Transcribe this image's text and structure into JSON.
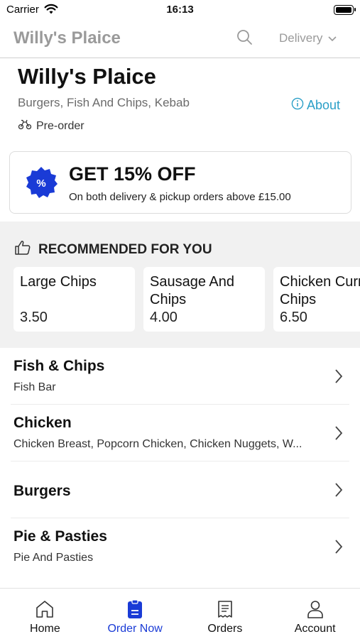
{
  "status": {
    "carrier": "Carrier",
    "time": "16:13"
  },
  "nav": {
    "title": "Willy's Plaice",
    "delivery_label": "Delivery"
  },
  "restaurant": {
    "name": "Willy's Plaice",
    "cuisine": "Burgers, Fish And Chips, Kebab",
    "about_label": "About",
    "preorder_label": "Pre-order"
  },
  "offer": {
    "title": "GET 15% OFF",
    "subtitle": "On both delivery & pickup orders above £15.00",
    "badge_color": "#1a3bd6"
  },
  "recommended": {
    "heading": "RECOMMENDED FOR YOU",
    "items": [
      {
        "name": "Large Chips",
        "price": "3.50"
      },
      {
        "name": "Sausage And Chips",
        "price": "4.00"
      },
      {
        "name": "Chicken Curry & Chips",
        "price": "6.50"
      }
    ]
  },
  "categories": [
    {
      "title": "Fish & Chips",
      "subtitle": "Fish Bar"
    },
    {
      "title": "Chicken",
      "subtitle": "Chicken Breast, Popcorn Chicken, Chicken Nuggets, W..."
    },
    {
      "title": "Burgers",
      "subtitle": ""
    },
    {
      "title": "Pie & Pasties",
      "subtitle": "Pie And Pasties"
    }
  ],
  "bottom_nav": {
    "tabs": [
      {
        "label": "Home",
        "icon": "home-icon"
      },
      {
        "label": "Order Now",
        "icon": "order-now-icon"
      },
      {
        "label": "Orders",
        "icon": "receipt-icon"
      },
      {
        "label": "Account",
        "icon": "person-icon"
      }
    ],
    "active_tab": "Order Now",
    "active_color": "#1a3bd6"
  }
}
